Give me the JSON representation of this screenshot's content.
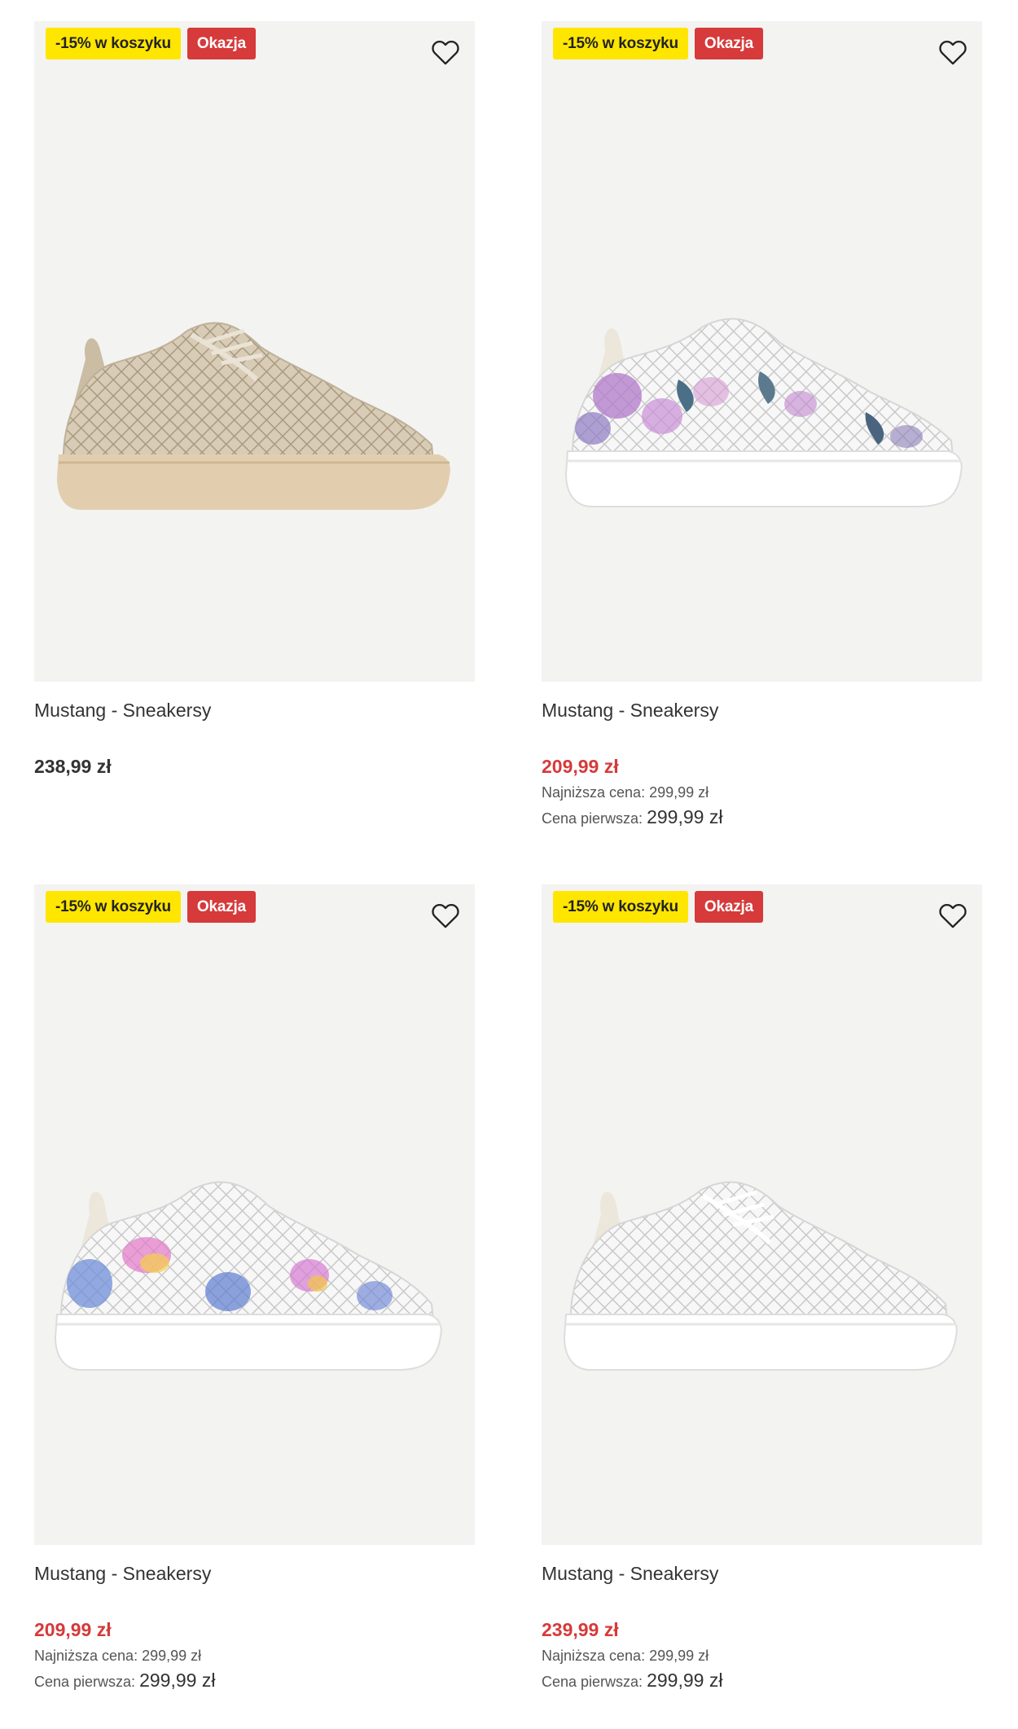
{
  "products": [
    {
      "promo_badge": "-15% w koszyku",
      "deal_badge": "Okazja",
      "title": "Mustang - Sneakersy",
      "price": "238,99 zł",
      "lowest_price_label": "",
      "lowest_price": "",
      "first_price_label": "",
      "first_price": "",
      "shoe_style": "beige lace knit upper with beige platform sole"
    },
    {
      "promo_badge": "-15% w koszyku",
      "deal_badge": "Okazja",
      "title": "Mustang - Sneakersy",
      "price": "209,99 zł",
      "lowest_price_label": "Najniższa cena:",
      "lowest_price": "299,99 zł",
      "first_price_label": "Cena pierwsza:",
      "first_price": "299,99 zł",
      "shoe_style": "white crochet upper with purple floral print, white platform sole"
    },
    {
      "promo_badge": "-15% w koszyku",
      "deal_badge": "Okazja",
      "title": "Mustang - Sneakersy",
      "price": "209,99 zł",
      "lowest_price_label": "Najniższa cena:",
      "lowest_price": "299,99 zł",
      "first_price_label": "Cena pierwsza:",
      "first_price": "299,99 zł",
      "shoe_style": "white crochet upper with rainbow heart print, white platform sole"
    },
    {
      "promo_badge": "-15% w koszyku",
      "deal_badge": "Okazja",
      "title": "Mustang - Sneakersy",
      "price": "239,99 zł",
      "lowest_price_label": "Najniższa cena:",
      "lowest_price": "299,99 zł",
      "first_price_label": "Cena pierwsza:",
      "first_price": "299,99 zł",
      "shoe_style": "white crochet upper with white platform sole"
    }
  ],
  "colors": {
    "promo_badge_bg": "#ffe600",
    "deal_badge_bg": "#d63a3a",
    "sale_price": "#d63a3a",
    "image_bg": "#f3f3f2"
  },
  "icons": {
    "wishlist": "heart-outline-icon"
  }
}
